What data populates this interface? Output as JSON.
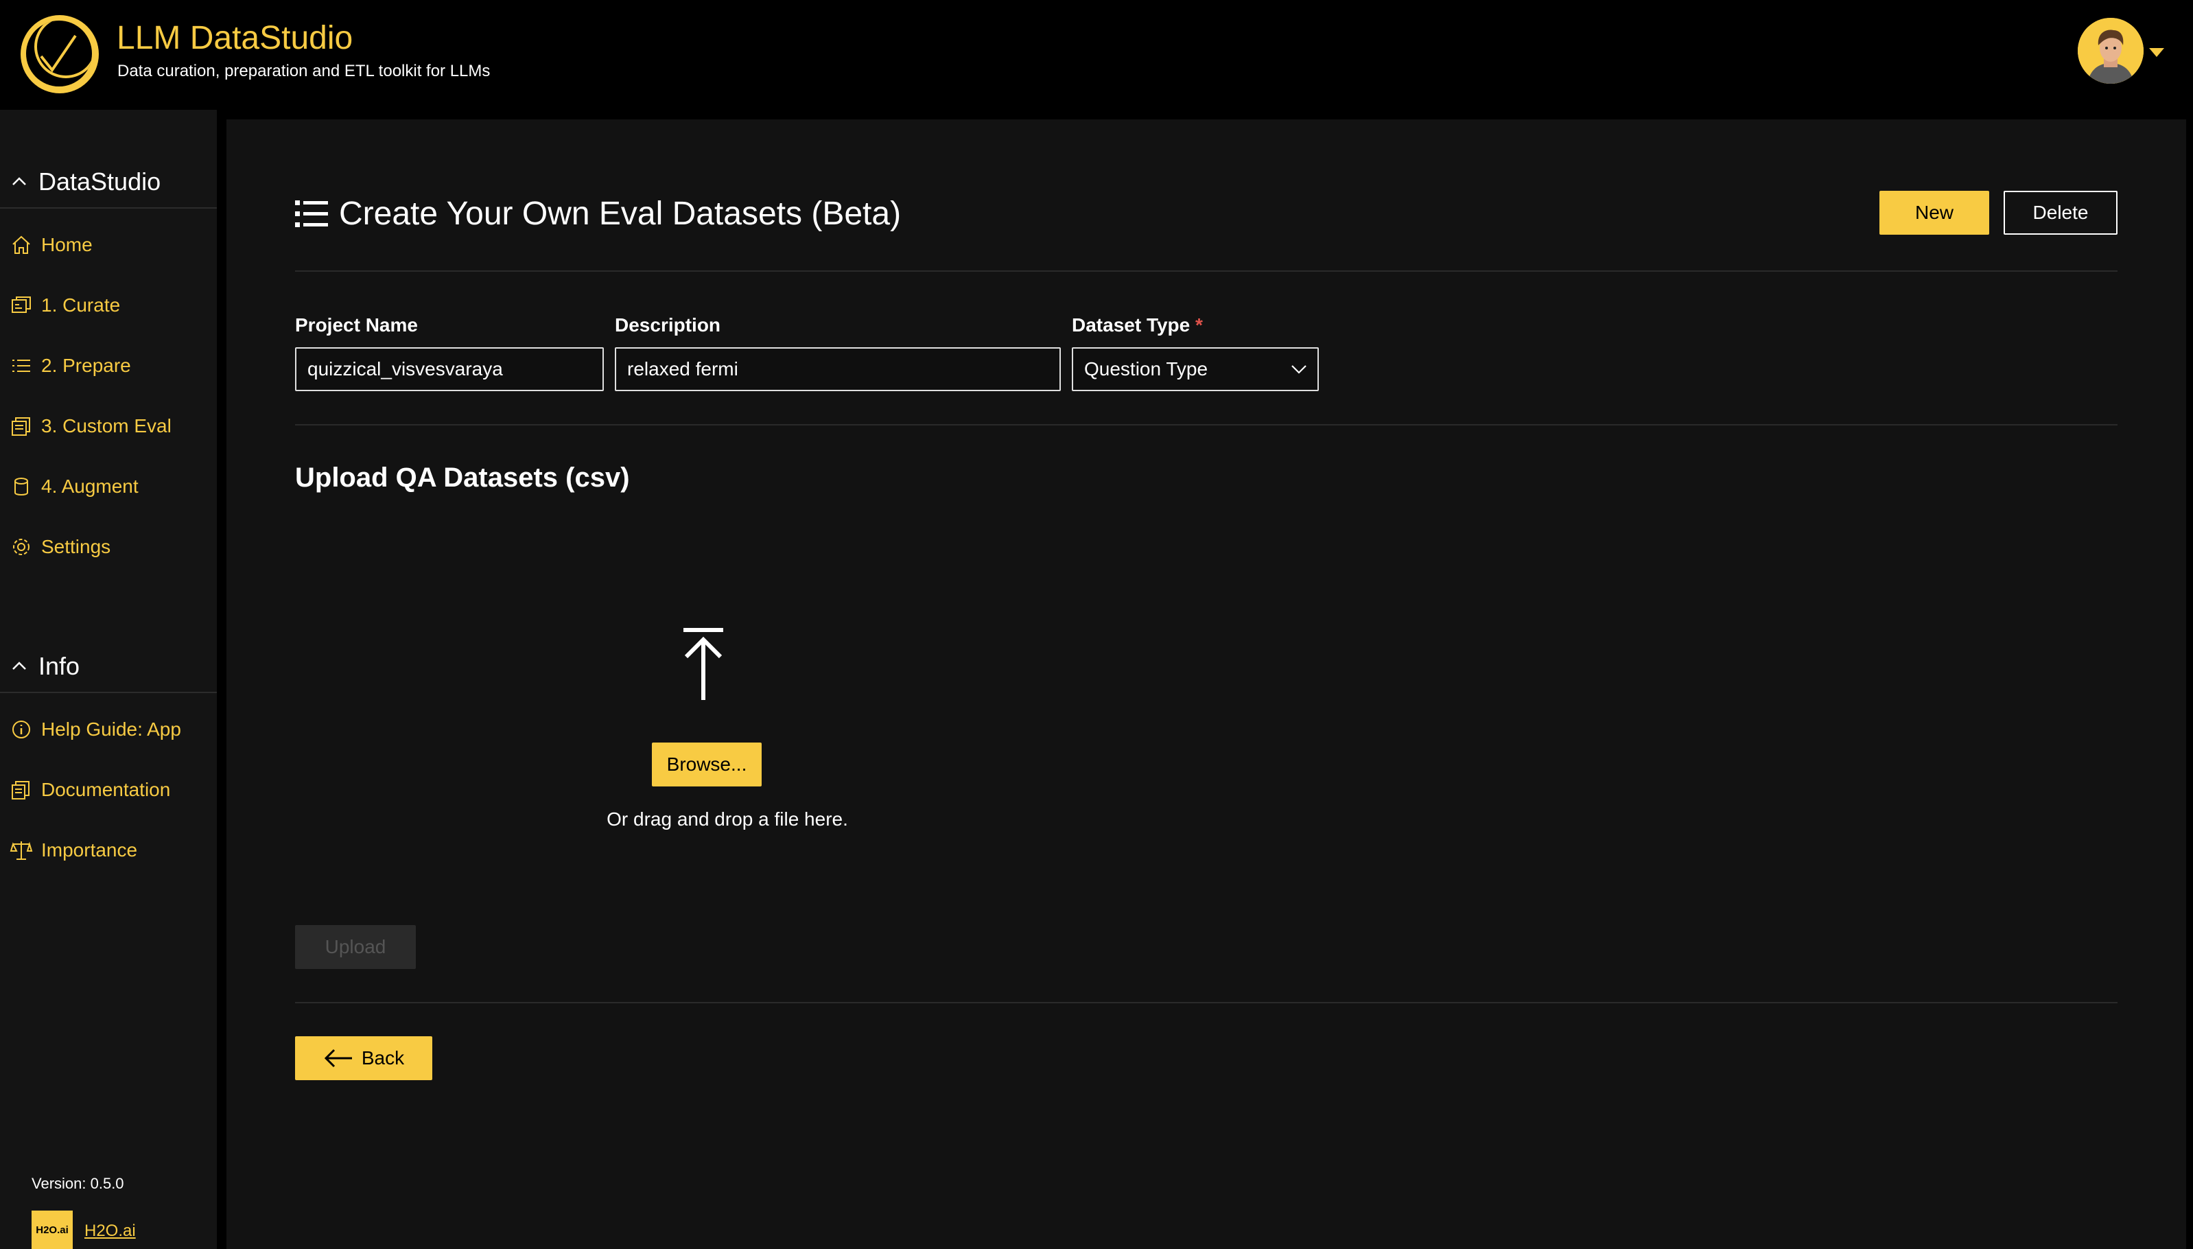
{
  "header": {
    "app_title": "LLM DataStudio",
    "app_subtitle": "Data curation, preparation and ETL toolkit for LLMs"
  },
  "sidebar": {
    "section1": "DataStudio",
    "items1": [
      {
        "label": "Home",
        "icon": "home-icon"
      },
      {
        "label": "1. Curate",
        "icon": "curate-icon"
      },
      {
        "label": "2. Prepare",
        "icon": "list-icon"
      },
      {
        "label": "3. Custom Eval",
        "icon": "document-stack-icon"
      },
      {
        "label": "4. Augment",
        "icon": "database-icon"
      },
      {
        "label": "Settings",
        "icon": "gear-icon"
      }
    ],
    "section2": "Info",
    "items2": [
      {
        "label": "Help Guide: App",
        "icon": "info-icon"
      },
      {
        "label": "Documentation",
        "icon": "documentation-icon"
      },
      {
        "label": "Importance",
        "icon": "scales-icon"
      }
    ],
    "version": "Version: 0.5.0",
    "h2o_logo_text": "H2O.ai",
    "h2o_link": "H2O.ai"
  },
  "main": {
    "title": "Create Your Own Eval Datasets (Beta)",
    "new_label": "New",
    "delete_label": "Delete",
    "project_name_label": "Project Name",
    "project_name_value": "quizzical_visvesvaraya",
    "description_label": "Description",
    "description_value": "relaxed fermi",
    "dataset_type_label": "Dataset Type",
    "dataset_type_required": "*",
    "dataset_type_value": "Question Type",
    "upload_section_title": "Upload QA Datasets (csv)",
    "browse_label": "Browse...",
    "drop_text": "Or drag and drop a file here.",
    "upload_label": "Upload",
    "back_label": "Back"
  },
  "colors": {
    "accent": "#f8cb43",
    "background": "#000000",
    "panel": "#121212",
    "sidebar": "#141414",
    "required": "#e0534b"
  }
}
